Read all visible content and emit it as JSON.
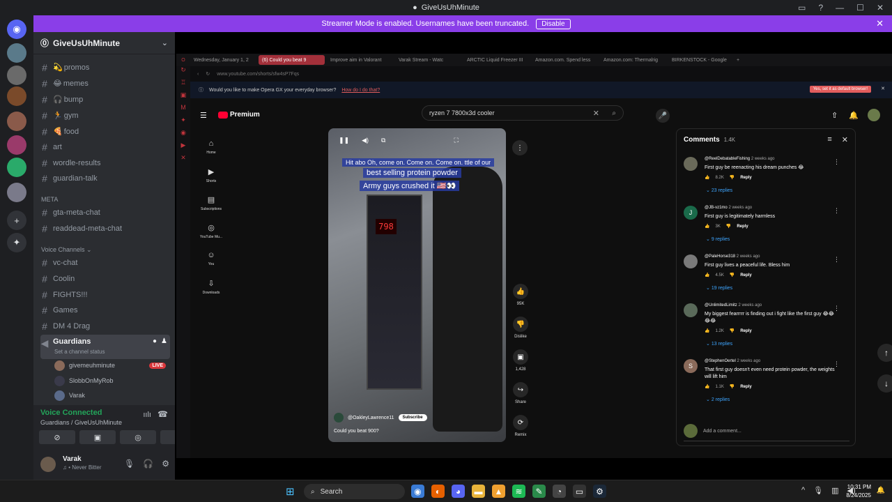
{
  "window": {
    "title": "GiveUsUhMinute"
  },
  "banner": {
    "text": "Streamer Mode is enabled. Usernames have been truncated.",
    "button": "Disable"
  },
  "guild": {
    "name": "GiveUsUhMinute"
  },
  "channels": {
    "text": [
      {
        "icon": "💫",
        "name": "promos"
      },
      {
        "icon": "😂",
        "name": "memes"
      },
      {
        "icon": "🎧",
        "name": "bump"
      },
      {
        "icon": "🏃",
        "name": "gym"
      },
      {
        "icon": "🍕",
        "name": "food"
      },
      {
        "icon": "",
        "name": "art"
      },
      {
        "icon": "",
        "name": "wordle-results"
      },
      {
        "icon": "",
        "name": "guardian-talk"
      }
    ],
    "meta_label": "META",
    "meta": [
      {
        "name": "gta-meta-chat"
      },
      {
        "name": "readdead-meta-chat"
      }
    ],
    "voice_label": "Voice Channels",
    "voice": [
      {
        "name": "vc-chat"
      },
      {
        "name": "Coolin"
      },
      {
        "name": "FIGHTS!!!"
      },
      {
        "name": "Games"
      },
      {
        "name": "DM 4 Drag"
      }
    ],
    "active_voice": {
      "name": "Guardians",
      "status": "Set a channel status"
    },
    "members": [
      {
        "name": "givemeuhminute",
        "live": "LIVE"
      },
      {
        "name": "SlobbOnMyRob",
        "live": ""
      },
      {
        "name": "Varak",
        "live": ""
      }
    ]
  },
  "voice_panel": {
    "status": "Voice Connected",
    "channel": "Guardians / GiveUsUhMinute"
  },
  "user": {
    "name": "Varak",
    "status": "Never Bitter"
  },
  "browser": {
    "tabs": [
      {
        "label": "Wednesday, January 1, 2",
        "active": false
      },
      {
        "label": "(6) Could you beat 9",
        "active": true
      },
      {
        "label": "Improve aim in Valorant",
        "active": false
      },
      {
        "label": "Varak Stream - Watc",
        "active": false
      },
      {
        "label": "ARCTIC Liquid Freezer III",
        "active": false
      },
      {
        "label": "Amazon.com. Spend less",
        "active": false
      },
      {
        "label": "Amazon.com: Thermalrig",
        "active": false
      },
      {
        "label": "BIRKENSTOCK - Google",
        "active": false
      }
    ],
    "url": "www.youtube.com/shorts/sfw4sP7Fqs",
    "prompt": {
      "text": "Would you like to make Opera GX your everyday browser?",
      "link": "How do I do that?",
      "button": "Yes, set it as default browser!"
    }
  },
  "youtube": {
    "logo": "Premium",
    "search": "ryzen 7 7800x3d cooler",
    "nav": [
      {
        "icon": "⌂",
        "label": "Home"
      },
      {
        "icon": "▶",
        "label": "Shorts"
      },
      {
        "icon": "▤",
        "label": "Subscriptions"
      },
      {
        "icon": "◎",
        "label": "YouTube Mu..."
      },
      {
        "icon": "☺",
        "label": "You"
      },
      {
        "icon": "⇩",
        "label": "Downloads"
      }
    ],
    "short": {
      "caption1": "Hit abo  Oh, come on. Come on. Come on.  ttle of our",
      "caption2": "best selling protein powder",
      "caption3": "Army guys crushed it 🇺🇸👀",
      "score": "798",
      "channel": "@OakleyLawrence11",
      "subscribe": "Subscribe",
      "description": "Could you beat 900?"
    },
    "actions": [
      {
        "icon": "👍",
        "label": "95K"
      },
      {
        "icon": "👎",
        "label": "Dislike"
      },
      {
        "icon": "▣",
        "label": "1,428"
      },
      {
        "icon": "↪",
        "label": "Share"
      },
      {
        "icon": "⟳",
        "label": "Remix"
      }
    ],
    "comments": {
      "title": "Comments",
      "count": "1.4K",
      "items": [
        {
          "avatar": "",
          "user": "@ReelDebatableFishing",
          "time": "2 weeks ago",
          "text": "First guy be reenacting his dream punches 😂",
          "likes": "8.2K",
          "reply": "Reply",
          "replies": "23 replies"
        },
        {
          "avatar": "J",
          "user": "@JB-vz1mo",
          "time": "2 weeks ago",
          "text": "First guy is legitimately harmless",
          "likes": "3K",
          "reply": "Reply",
          "replies": "9 replies"
        },
        {
          "avatar": "",
          "user": "@PaleHorse318",
          "time": "2 weeks ago",
          "text": "First guy lives a peaceful life. Bless him",
          "likes": "4.5K",
          "reply": "Reply",
          "replies": "19 replies"
        },
        {
          "avatar": "",
          "user": "@UnlimitedLimitz",
          "time": "2 weeks ago",
          "text": "My biggest fearrrrr is finding out i fight like the first guy 😂😂😂😂",
          "likes": "1.2K",
          "reply": "Reply",
          "replies": "13 replies"
        },
        {
          "avatar": "S",
          "user": "@StephenOertel",
          "time": "2 weeks ago",
          "text": "That first guy doesn't even need protein powder, the weights will lift him",
          "likes": "1.1K",
          "reply": "Reply",
          "replies": "2 replies"
        }
      ],
      "add_placeholder": "Add a comment..."
    }
  },
  "taskbar": {
    "search": "Search",
    "time": "10:31 PM",
    "date": "8/24/2025"
  }
}
